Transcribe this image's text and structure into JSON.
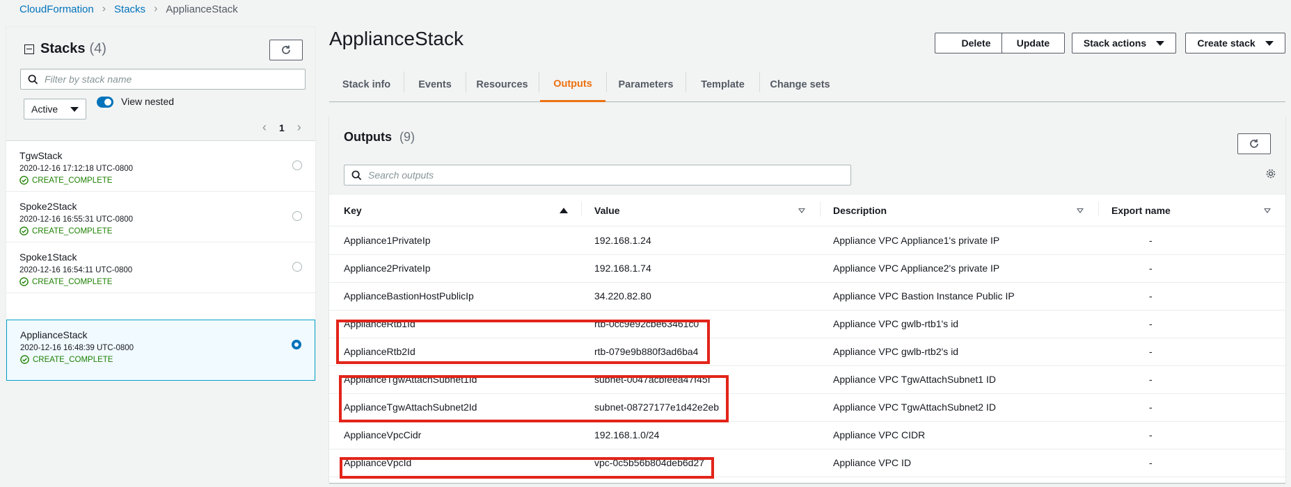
{
  "breadcrumb": {
    "items": [
      "CloudFormation",
      "Stacks"
    ],
    "current": "ApplianceStack"
  },
  "sidebar": {
    "title": "Stacks",
    "count": "(4)",
    "filter_placeholder": "Filter by stack name",
    "status_filter": "Active",
    "view_nested_label": "View nested",
    "page": "1",
    "stacks": [
      {
        "name": "TgwStack",
        "date": "2020-12-16 17:12:18 UTC-0800",
        "status": "CREATE_COMPLETE",
        "selected": false
      },
      {
        "name": "Spoke2Stack",
        "date": "2020-12-16 16:55:31 UTC-0800",
        "status": "CREATE_COMPLETE",
        "selected": false
      },
      {
        "name": "Spoke1Stack",
        "date": "2020-12-16 16:54:11 UTC-0800",
        "status": "CREATE_COMPLETE",
        "selected": false
      },
      {
        "name": "ApplianceStack",
        "date": "2020-12-16 16:48:39 UTC-0800",
        "status": "CREATE_COMPLETE",
        "selected": true
      }
    ]
  },
  "header": {
    "title": "ApplianceStack",
    "buttons": {
      "delete": "Delete",
      "update": "Update",
      "stack_actions": "Stack actions",
      "create_stack": "Create stack"
    }
  },
  "tabs": [
    "Stack info",
    "Events",
    "Resources",
    "Outputs",
    "Parameters",
    "Template",
    "Change sets"
  ],
  "active_tab": "Outputs",
  "outputs": {
    "title": "Outputs",
    "count": "(9)",
    "search_placeholder": "Search outputs",
    "columns": [
      "Key",
      "Value",
      "Description",
      "Export name"
    ],
    "rows": [
      [
        "Appliance1PrivateIp",
        "192.168.1.24",
        "Appliance VPC Appliance1's private IP",
        "-"
      ],
      [
        "Appliance2PrivateIp",
        "192.168.1.74",
        "Appliance VPC Appliance2's private IP",
        "-"
      ],
      [
        "ApplianceBastionHostPublicIp",
        "34.220.82.80",
        "Appliance VPC Bastion Instance Public IP",
        "-"
      ],
      [
        "ApplianceRtb1Id",
        "rtb-0cc9e92cbe63461c0",
        "Appliance VPC gwlb-rtb1's id",
        "-"
      ],
      [
        "ApplianceRtb2Id",
        "rtb-079e9b880f3ad6ba4",
        "Appliance VPC gwlb-rtb2's id",
        "-"
      ],
      [
        "ApplianceTgwAttachSubnet1Id",
        "subnet-0047acbfeea47f45f",
        "Appliance VPC TgwAttachSubnet1 ID",
        "-"
      ],
      [
        "ApplianceTgwAttachSubnet2Id",
        "subnet-08727177e1d42e2eb",
        "Appliance VPC TgwAttachSubnet2 ID",
        "-"
      ],
      [
        "ApplianceVpcCidr",
        "192.168.1.0/24",
        "Appliance VPC CIDR",
        "-"
      ],
      [
        "ApplianceVpcId",
        "vpc-0c5b56b804deb6d27",
        "Appliance VPC ID",
        "-"
      ]
    ]
  },
  "colors": {
    "link": "#0073bb",
    "accent": "#ec7211",
    "success": "#1d8102",
    "highlight": "#e2241a"
  }
}
